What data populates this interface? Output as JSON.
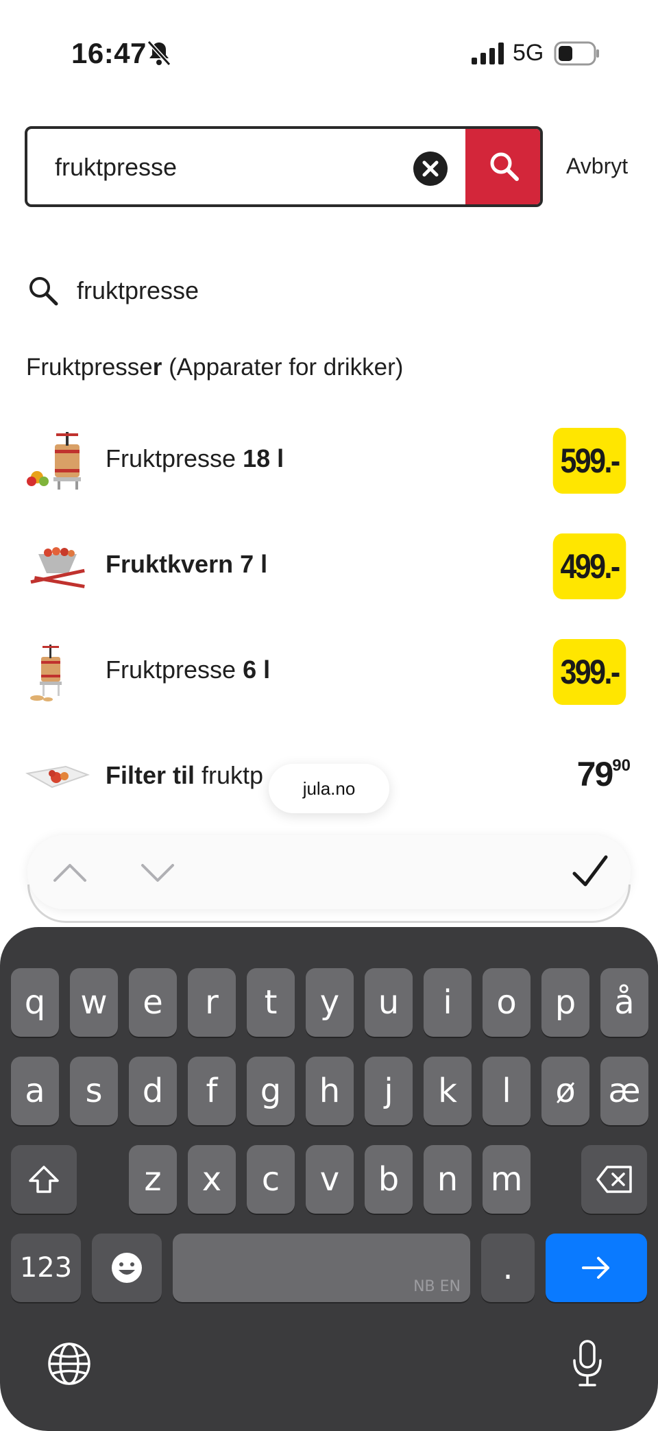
{
  "status_bar": {
    "time": "16:47",
    "network": "5G"
  },
  "search": {
    "query": "fruktpresse",
    "cancel_label": "Avbryt"
  },
  "suggestion": {
    "text": "fruktpresse"
  },
  "category": {
    "name_normal": "Fruktpresse",
    "name_bold": "r",
    "context": " (Apparater for drikker)"
  },
  "products": [
    {
      "name_normal": "Fruktpresse ",
      "name_bold": "18 l",
      "price": "599.-",
      "price_style": "tag"
    },
    {
      "name_normal": "",
      "name_bold": "Fruktkvern 7 l",
      "price": "499.-",
      "price_style": "tag"
    },
    {
      "name_normal": "Fruktpresse ",
      "name_bold": "6 l",
      "price": "399.-",
      "price_style": "tag"
    },
    {
      "name_bold_first": "Filter til",
      "name_normal_after": " fruktp",
      "price_main": "79",
      "price_cents": "90",
      "price_style": "plain"
    }
  ],
  "browser": {
    "url": "jula.no"
  },
  "keyboard": {
    "row1": [
      "q",
      "w",
      "e",
      "r",
      "t",
      "y",
      "u",
      "i",
      "o",
      "p",
      "å"
    ],
    "row2": [
      "a",
      "s",
      "d",
      "f",
      "g",
      "h",
      "j",
      "k",
      "l",
      "ø",
      "æ"
    ],
    "row3": [
      "z",
      "x",
      "c",
      "v",
      "b",
      "n",
      "m"
    ],
    "numbers_label": "123",
    "space_hint": "NB EN",
    "period": "."
  },
  "icons": {
    "bell_muted": "bell-slash-icon",
    "signal": "signal-icon",
    "battery": "battery-icon",
    "clear": "close-icon",
    "search": "search-icon",
    "shift": "shift-icon",
    "delete": "backspace-icon",
    "emoji": "emoji-icon",
    "go": "arrow-right-icon",
    "globe": "globe-icon",
    "mic": "microphone-icon",
    "prev": "chevron-up-icon",
    "next": "chevron-down-icon",
    "done": "checkmark-icon"
  },
  "colors": {
    "brand_red": "#d3263a",
    "price_yellow": "#ffe600",
    "keyboard_bg": "#3b3b3d",
    "go_blue": "#0a7aff"
  }
}
